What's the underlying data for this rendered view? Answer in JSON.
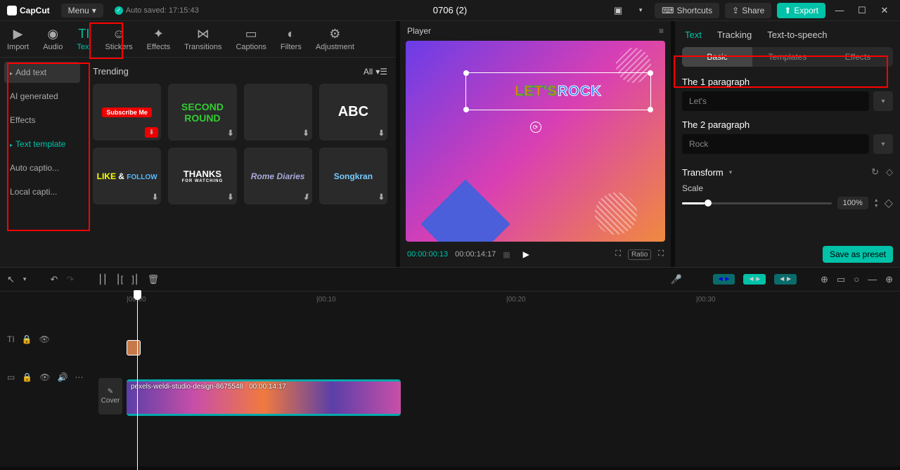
{
  "titlebar": {
    "app": "CapCut",
    "menu": "Menu",
    "autosave": "Auto saved: 17:15:43",
    "project": "0706 (2)",
    "shortcuts": "Shortcuts",
    "share": "Share",
    "export": "Export"
  },
  "toolTabs": {
    "import": "Import",
    "audio": "Audio",
    "text": "Text",
    "stickers": "Stickers",
    "effects": "Effects",
    "transitions": "Transitions",
    "captions": "Captions",
    "filters": "Filters",
    "adjustment": "Adjustment"
  },
  "textSidebar": {
    "addText": "Add text",
    "aiGen": "AI generated",
    "effects": "Effects",
    "template": "Text template",
    "autoCap": "Auto captio...",
    "localCap": "Local capti..."
  },
  "templates": {
    "heading": "Trending",
    "all": "All",
    "cards": {
      "c1": "Subscribe Me",
      "c2": "SECOND ROUND",
      "c3": "ABC",
      "c4a": "LIKE",
      "c4b": " & ",
      "c4c": "FOLLOW",
      "c5a": "THANKS",
      "c5b": "FOR WATCHING",
      "c6": "Rome Diaries",
      "c7": "Songkran"
    }
  },
  "player": {
    "title": "Player",
    "text1": "LET'S",
    "text2": "ROCK",
    "timeCurrent": "00:00:00:13",
    "timeTotal": "00:00:14:17",
    "ratio": "Ratio"
  },
  "rightPanel": {
    "tabs": {
      "text": "Text",
      "tracking": "Tracking",
      "tts": "Text-to-speech"
    },
    "subtabs": {
      "basic": "Basic",
      "templates": "Templates",
      "effects": "Effects"
    },
    "p1Label": "The 1 paragraph",
    "p1Value": "Let's",
    "p2Label": "The 2 paragraph",
    "p2Value": "Rock",
    "transform": "Transform",
    "scale": "Scale",
    "scaleValue": "100%",
    "savePreset": "Save as preset"
  },
  "timeline": {
    "ticks": {
      "t0": "|00:00",
      "t10": "|00:10",
      "t20": "|00:20",
      "t30": "|00:30"
    },
    "clipName": "pexels-weldi-studio-design-8675548",
    "clipDur": "00:00:14:17",
    "cover": "Cover"
  }
}
